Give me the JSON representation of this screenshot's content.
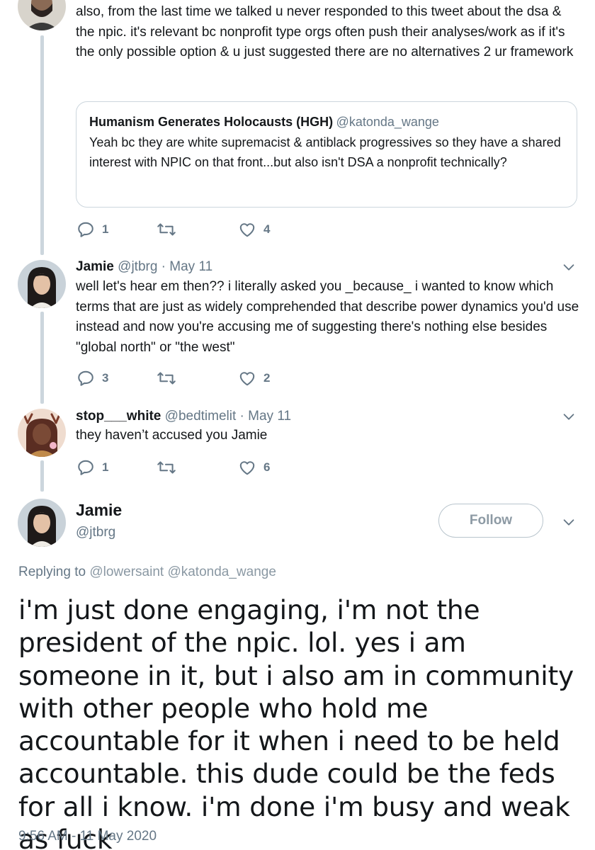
{
  "thread": {
    "tweet1": {
      "text": "also, from the last time we talked u never responded to this tweet about the dsa & the npic. it's relevant bc nonprofit type orgs often push their analyses/work as if it's the only possible option & u just suggested there are no alternatives 2 ur framework",
      "quote": {
        "name": "Humanism Generates Holocausts (HGH)",
        "handle": "@katonda_wange",
        "text": "Yeah bc they are white supremacist & antiblack progressives so they have a shared interest with NPIC on that front...but also isn't DSA a nonprofit technically?"
      },
      "reply_count": "1",
      "retweet_count": "",
      "like_count": "4"
    },
    "tweet2": {
      "name": "Jamie",
      "meta": "@jtbrg · May 11",
      "text": "well let's hear em then?? i literally asked you _because_ i wanted to know which terms that are just as widely comprehended that describe power dynamics you'd use instead and now you're accusing me of suggesting there's nothing else besides \"global north\" or \"the west\"",
      "reply_count": "3",
      "retweet_count": "",
      "like_count": "2"
    },
    "tweet3": {
      "name": "stop___white",
      "meta": "@bedtimelit · May 11",
      "text": "they haven’t accused you Jamie",
      "reply_count": "1",
      "retweet_count": "",
      "like_count": "6"
    }
  },
  "focus": {
    "name": "Jamie",
    "handle": "@jtbrg",
    "follow_label": "Follow",
    "replying_prefix": "Replying to",
    "replying_to_1": "@lowersaint",
    "replying_to_2": "@katonda_wange",
    "text": "i'm just done engaging, i'm not the president of the npic. lol. yes i am someone in it, but i also am in community with other people who hold me accountable for it when i need to be held accountable. this dude could be the feds for all i know. i'm done i'm busy and weak as fuck",
    "timestamp": "9:56 AM - 11 May 2020"
  },
  "colors": {
    "text": "#14171a",
    "secondary": "#657786",
    "border": "#ccd6dd"
  }
}
